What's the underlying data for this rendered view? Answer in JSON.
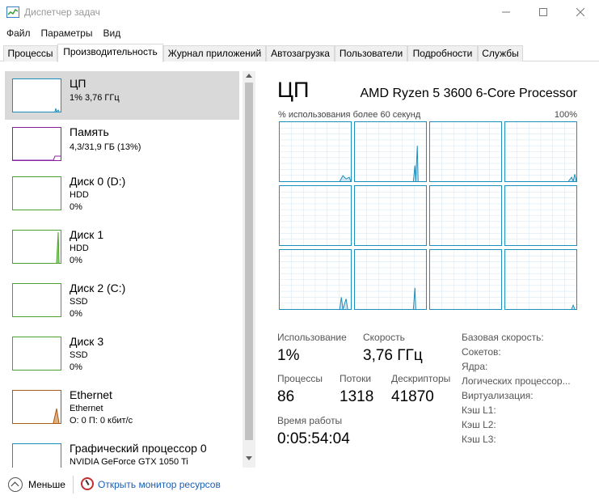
{
  "window": {
    "title": "Диспетчер задач"
  },
  "menu": [
    "Файл",
    "Параметры",
    "Вид"
  ],
  "tabs": [
    "Процессы",
    "Производительность",
    "Журнал приложений",
    "Автозагрузка",
    "Пользователи",
    "Подробности",
    "Службы"
  ],
  "sidebar": [
    {
      "title": "ЦП",
      "line1": "1% 3,76 ГГц",
      "line2": "",
      "color": "#1a8ebc"
    },
    {
      "title": "Память",
      "line1": "4,3/31,9 ГБ (13%)",
      "line2": "",
      "color": "#8b1fa2"
    },
    {
      "title": "Диск 0 (D:)",
      "line1": "HDD",
      "line2": "0%",
      "color": "#4da030"
    },
    {
      "title": "Диск 1",
      "line1": "HDD",
      "line2": "0%",
      "color": "#4da030"
    },
    {
      "title": "Диск 2 (C:)",
      "line1": "SSD",
      "line2": "0%",
      "color": "#4da030"
    },
    {
      "title": "Диск 3",
      "line1": "SSD",
      "line2": "0%",
      "color": "#4da030"
    },
    {
      "title": "Ethernet",
      "line1": "Ethernet",
      "line2": "О: 0 П: 0 кбит/с",
      "color": "#a75b16"
    },
    {
      "title": "Графический процессор 0",
      "line1": "NVIDIA GeForce GTX 1050 Ti",
      "line2": "",
      "color": "#1a8ebc"
    }
  ],
  "cpu": {
    "title": "ЦП",
    "model": "AMD Ryzen 5 3600 6-Core Processor",
    "graph_caption": "% использования более 60 секунд",
    "graph_max": "100%"
  },
  "stats": {
    "usage_label": "Использование",
    "usage_value": "1%",
    "speed_label": "Скорость",
    "speed_value": "3,76 ГГц",
    "processes_label": "Процессы",
    "processes_value": "86",
    "threads_label": "Потоки",
    "threads_value": "1318",
    "handles_label": "Дескрипторы",
    "handles_value": "41870",
    "uptime_label": "Время работы",
    "uptime_value": "0:05:54:04"
  },
  "specs": [
    "Базовая скорость:",
    "Сокетов:",
    "Ядра:",
    "Логических процессор...",
    "Виртуализация:",
    "Кэш L1:",
    "Кэш L2:",
    "Кэш L3:"
  ],
  "footer": {
    "less": "Меньше",
    "resmon": "Открыть монитор ресурсов"
  }
}
